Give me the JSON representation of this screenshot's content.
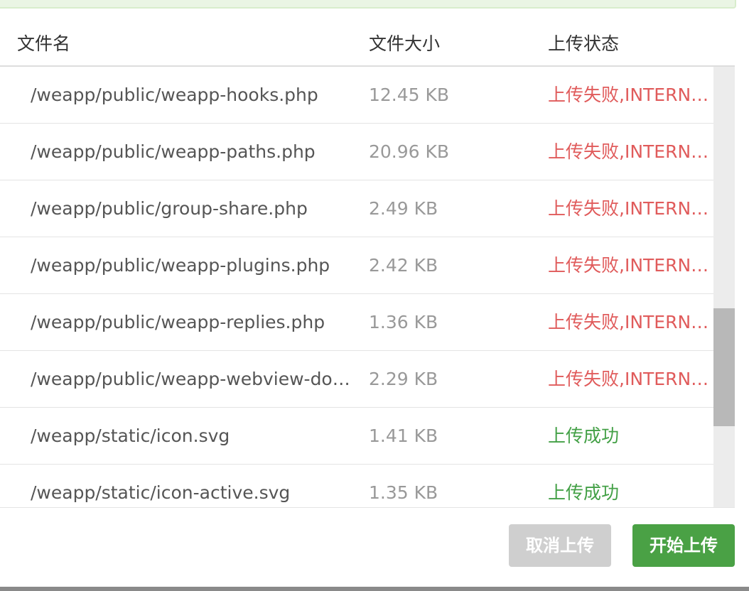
{
  "header": {
    "col_name": "文件名",
    "col_size": "文件大小",
    "col_status": "上传状态"
  },
  "colors": {
    "fail": "#e05b5b",
    "success": "#43a046",
    "primary_button": "#4aa145",
    "disabled_button": "#cfcfcf"
  },
  "files": [
    {
      "name": "/weapp/public/weapp-hooks.php",
      "size": "12.45 KB",
      "status": "上传失败,INTERNAL_ERROR",
      "state": "fail"
    },
    {
      "name": "/weapp/public/weapp-paths.php",
      "size": "20.96 KB",
      "status": "上传失败,INTERNAL_ERROR",
      "state": "fail"
    },
    {
      "name": "/weapp/public/group-share.php",
      "size": "2.49 KB",
      "status": "上传失败,INTERNAL_ERROR",
      "state": "fail"
    },
    {
      "name": "/weapp/public/weapp-plugins.php",
      "size": "2.42 KB",
      "status": "上传失败,INTERNAL_ERROR",
      "state": "fail"
    },
    {
      "name": "/weapp/public/weapp-replies.php",
      "size": "1.36 KB",
      "status": "上传失败,INTERNAL_ERROR",
      "state": "fail"
    },
    {
      "name": "/weapp/public/weapp-webview-domains.php",
      "size": "2.29 KB",
      "status": "上传失败,INTERNAL_ERROR",
      "state": "fail"
    },
    {
      "name": "/weapp/static/icon.svg",
      "size": "1.41 KB",
      "status": "上传成功",
      "state": "success"
    },
    {
      "name": "/weapp/static/icon-active.svg",
      "size": "1.35 KB",
      "status": "上传成功",
      "state": "success"
    }
  ],
  "buttons": {
    "cancel": "取消上传",
    "start": "开始上传"
  }
}
